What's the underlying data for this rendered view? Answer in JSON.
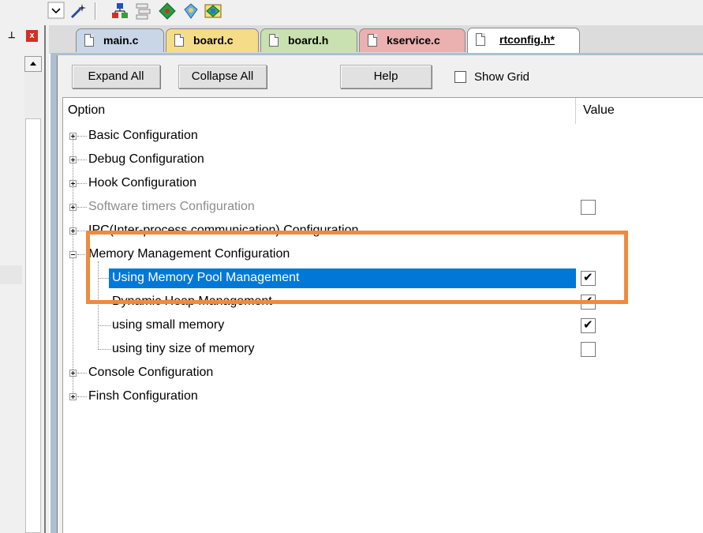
{
  "toolbar": {
    "icons": [
      "dropdown-arrow-icon",
      "magic-wand-icon",
      "network-icon",
      "stack-icon",
      "diamond-icon",
      "pin-icon",
      "component-icon"
    ]
  },
  "left_pane": {
    "pin_glyph": "⊥",
    "close_glyph": "x"
  },
  "tabs": [
    {
      "label": "main.c",
      "color": "#c9d6e8",
      "active": false
    },
    {
      "label": "board.c",
      "color": "#f5dc88",
      "active": false
    },
    {
      "label": "board.h",
      "color": "#c9e0b0",
      "active": false
    },
    {
      "label": "kservice.c",
      "color": "#ebb0b0",
      "active": false
    },
    {
      "label": "rtconfig.h*",
      "color": "#ffffff",
      "active": true
    }
  ],
  "buttons": {
    "expand_all": "Expand All",
    "collapse_all": "Collapse All",
    "help": "Help"
  },
  "show_grid": {
    "label": "Show Grid",
    "checked": false
  },
  "grid": {
    "col_option": "Option",
    "col_value": "Value",
    "rows": [
      {
        "label": "Basic Configuration",
        "expanded": false
      },
      {
        "label": "Debug Configuration",
        "expanded": false
      },
      {
        "label": "Hook Configuration",
        "expanded": false
      },
      {
        "label": "Software timers Configuration",
        "expanded": false,
        "disabled": true,
        "checkbox": false
      },
      {
        "label": "IPC(Inter-process communication) Configuration",
        "expanded": false
      },
      {
        "label": "Memory Management Configuration",
        "expanded": true
      },
      {
        "label": "Using Memory Pool Management",
        "child": true,
        "selected": true,
        "checkbox": true
      },
      {
        "label": "Dynamic Heap Management",
        "child": true,
        "checkbox": true
      },
      {
        "label": "using small memory",
        "child": true,
        "checkbox": true
      },
      {
        "label": "using tiny size of memory",
        "child": true,
        "checkbox": false
      },
      {
        "label": "Console Configuration",
        "expanded": false
      },
      {
        "label": "Finsh Configuration",
        "expanded": false
      }
    ]
  },
  "colors": {
    "selection": "#0078d7",
    "highlight_box": "#f08a3e",
    "disabled_text": "#8c8c8c"
  }
}
